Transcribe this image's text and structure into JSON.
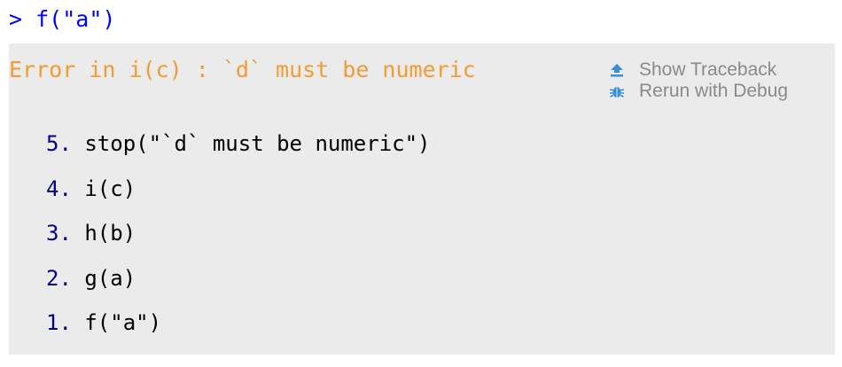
{
  "console": {
    "prompt": ">",
    "command": "f(\"a\")"
  },
  "error": {
    "message": "Error in i(c) : `d` must be numeric",
    "color": "#f39c33"
  },
  "actions": {
    "show_traceback": {
      "label": "Show Traceback",
      "icon": "arrow-up-icon",
      "icon_color": "#3a8fd6"
    },
    "rerun_debug": {
      "label": "Rerun with Debug",
      "icon": "bug-icon",
      "icon_color": "#3a8fd6"
    }
  },
  "traceback": [
    {
      "num": "5.",
      "call": "stop(\"`d` must be numeric\")"
    },
    {
      "num": "4.",
      "call": "i(c)"
    },
    {
      "num": "3.",
      "call": "h(b)"
    },
    {
      "num": "2.",
      "call": "g(a)"
    },
    {
      "num": "1.",
      "call": "f(\"a\")"
    }
  ]
}
